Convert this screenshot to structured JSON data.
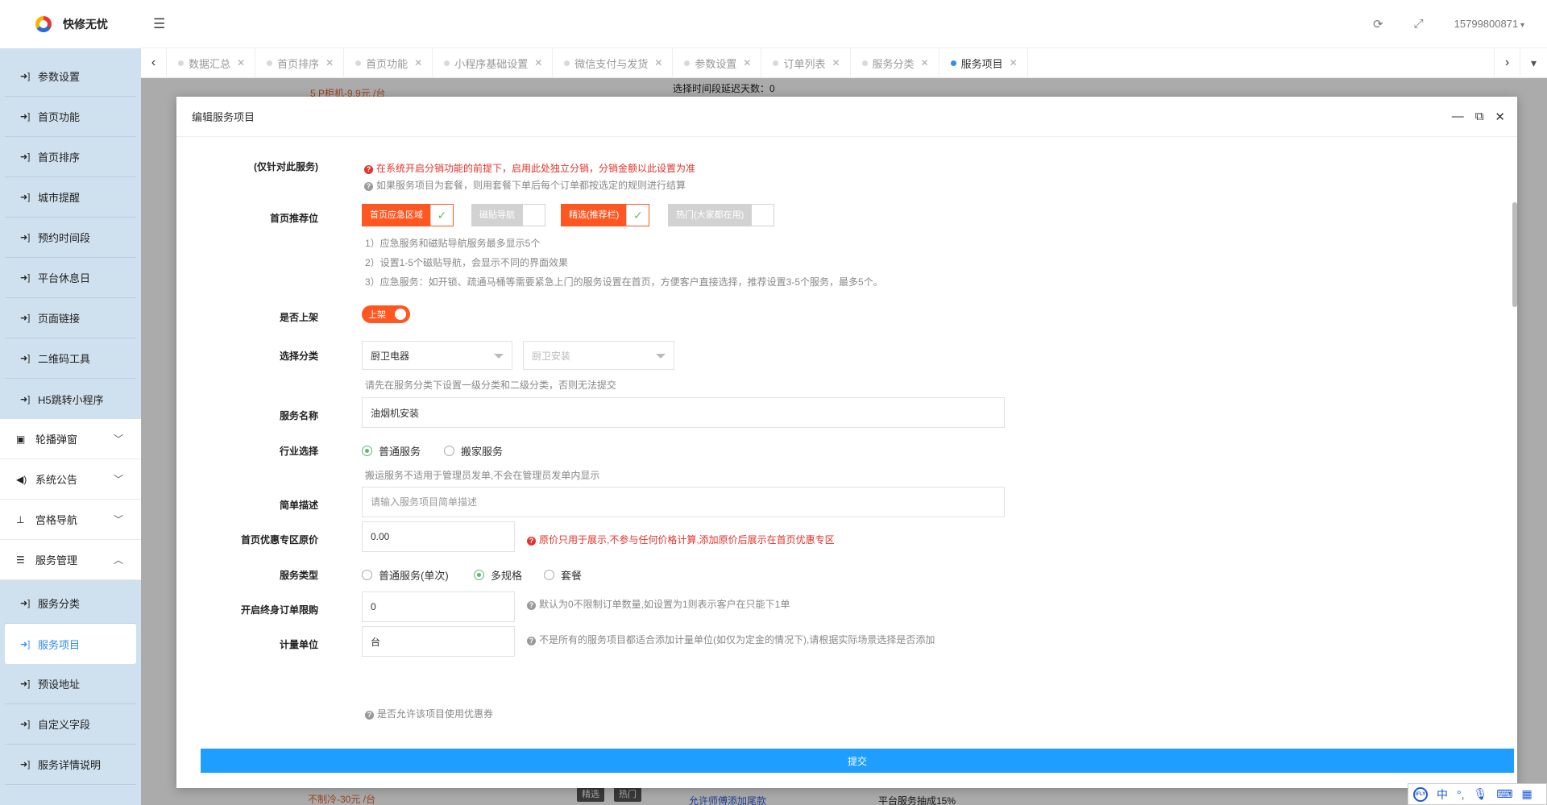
{
  "app": {
    "logo_text": "快修无忧"
  },
  "sidebar": {
    "items_top": [
      {
        "label": "参数设置"
      },
      {
        "label": "首页功能"
      },
      {
        "label": "首页排序"
      },
      {
        "label": "城市提醒"
      },
      {
        "label": "预约时间段"
      },
      {
        "label": "平台休息日"
      },
      {
        "label": "页面链接"
      },
      {
        "label": "二维码工具"
      },
      {
        "label": "H5跳转小程序"
      }
    ],
    "groups": [
      {
        "label": "轮播弹窗",
        "icon": "image-icon",
        "glyph": "▣",
        "chev": "﹀"
      },
      {
        "label": "系统公告",
        "icon": "speaker-icon",
        "glyph": "◀)",
        "chev": "﹀"
      },
      {
        "label": "宫格导航",
        "icon": "sitemap-icon",
        "glyph": "⊥",
        "chev": "﹀"
      },
      {
        "label": "服务管理",
        "icon": "server-icon",
        "glyph": "☰",
        "chev": "︿"
      }
    ],
    "items_bottom": [
      {
        "label": "服务分类",
        "active": false
      },
      {
        "label": "服务项目",
        "active": true
      },
      {
        "label": "预设地址",
        "active": false
      },
      {
        "label": "自定义字段",
        "active": false
      },
      {
        "label": "服务详情说明",
        "active": false
      }
    ]
  },
  "header": {
    "phone": "15799800871"
  },
  "tabs": [
    {
      "label": "数据汇总",
      "active": false
    },
    {
      "label": "首页排序",
      "active": false
    },
    {
      "label": "首页功能",
      "active": false
    },
    {
      "label": "小程序基础设置",
      "active": false
    },
    {
      "label": "微信支付与发货",
      "active": false
    },
    {
      "label": "参数设置",
      "active": false
    },
    {
      "label": "订单列表",
      "active": false
    },
    {
      "label": "服务分类",
      "active": false
    },
    {
      "label": "服务项目",
      "active": true
    }
  ],
  "background": {
    "frag1": "5 P柜机-9.9元 /台",
    "frag2": "选择时间段延迟天数：0",
    "frag3": "不制冷-30元 /台",
    "chip1": "精选",
    "chip2": "热门",
    "frag4": "允许师傅添加尾款",
    "frag5": "平台服务抽成15%"
  },
  "modal": {
    "title": "编辑服务项目",
    "submit": "提交",
    "distribution": {
      "label": "(仅针对此服务)",
      "hint_red": "在系统开启分销功能的前提下，启用此处独立分销，分销金额以此设置为准",
      "hint_gray": "如果服务项目为套餐，则用套餐下单后每个订单都按选定的规则进行结算"
    },
    "recommend": {
      "label": "首页推荐位",
      "options": [
        {
          "label": "首页应急区域",
          "checked": true
        },
        {
          "label": "磁贴导航",
          "checked": false
        },
        {
          "label": "精选(推荐栏)",
          "checked": true
        },
        {
          "label": "热门(大家都在用)",
          "checked": false
        }
      ],
      "notes": [
        "1）应急服务和磁贴导航服务最多显示5个",
        "2）设置1-5个磁贴导航，会显示不同的界面效果",
        "3）应急服务：如开锁、疏通马桶等需要紧急上门的服务设置在首页，方便客户直接选择，推荐设置3-5个服务，最多5个。"
      ]
    },
    "listed": {
      "label": "是否上架",
      "switch_text": "上架"
    },
    "category": {
      "label": "选择分类",
      "first": "厨卫电器",
      "second_placeholder": "厨卫安装",
      "hint": "请先在服务分类下设置一级分类和二级分类，否则无法提交"
    },
    "name": {
      "label": "服务名称",
      "value": "油烟机安装"
    },
    "industry": {
      "label": "行业选择",
      "options": [
        {
          "label": "普通服务",
          "selected": true
        },
        {
          "label": "搬家服务",
          "selected": false
        }
      ],
      "hint": "搬运服务不适用于管理员发单,不会在管理员发单内显示"
    },
    "desc": {
      "label": "简单描述",
      "placeholder": "请输入服务项目简单描述"
    },
    "orig_price": {
      "label": "首页优惠专区原价",
      "value": "0.00",
      "hint": "原价只用于展示,不参与任何价格计算,添加原价后展示在首页优惠专区"
    },
    "service_type": {
      "label": "服务类型",
      "options": [
        {
          "label": "普通服务(单次)",
          "selected": false
        },
        {
          "label": "多规格",
          "selected": true
        },
        {
          "label": "套餐",
          "selected": false
        }
      ]
    },
    "limit": {
      "label": "开启终身订单限购",
      "value": "0",
      "hint": "默认为0不限制订单数量,如设置为1则表示客户在只能下1单"
    },
    "unit": {
      "label": "计量单位",
      "value": "台",
      "hint": "不是所有的服务项目都适合添加计量单位(如仅为定金的情况下),请根据实际场景选择是否添加"
    },
    "coupon_hint": "是否允许该项目使用优惠券"
  },
  "ime": {
    "lang": "中"
  }
}
